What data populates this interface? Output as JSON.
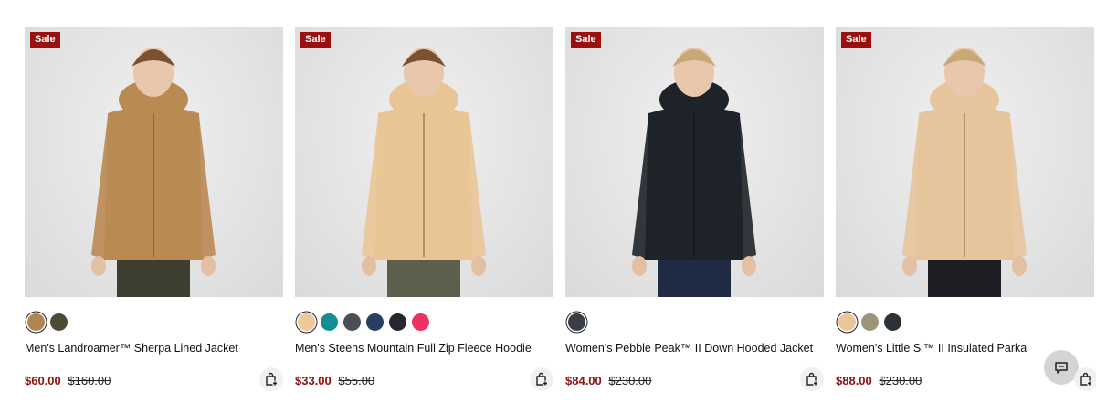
{
  "products": [
    {
      "badge": "Sale",
      "name": "Men's Landroamer™ Sherpa Lined Jacket",
      "sale_price": "$60.00",
      "original_price": "$160.00",
      "swatches": [
        "#b08554",
        "#4d4b36"
      ],
      "selected_swatch": 0,
      "jacket_color": "#b98a52",
      "pants_color": "#3d3d30"
    },
    {
      "badge": "Sale",
      "name": "Men's Steens Mountain Full Zip Fleece Hoodie",
      "sale_price": "$33.00",
      "original_price": "$55.00",
      "swatches": [
        "#edc89a",
        "#138f93",
        "#4b4f55",
        "#2a3e63",
        "#252830",
        "#ee3163"
      ],
      "selected_swatch": 0,
      "jacket_color": "#e9c595",
      "pants_color": "#5e5e4c"
    },
    {
      "badge": "Sale",
      "name": "Women's Pebble Peak™ II Down Hooded Jacket",
      "sale_price": "$84.00",
      "original_price": "$230.00",
      "swatches": [
        "#3a3f47"
      ],
      "selected_swatch": 0,
      "jacket_color": "#1e2329",
      "pants_color": "#1f2b45"
    },
    {
      "badge": "Sale",
      "name": "Women's Little Si™ II Insulated Parka",
      "sale_price": "$88.00",
      "original_price": "$230.00",
      "swatches": [
        "#ebc59a",
        "#9c957a",
        "#2c3138"
      ],
      "selected_swatch": 0,
      "jacket_color": "#e6c49c",
      "pants_color": "#1d1f24"
    }
  ],
  "colors": {
    "sale_badge": "#9b0f0f",
    "sale_price": "#8b1010"
  },
  "icons": {
    "cart": "add-to-bag-icon",
    "chat": "chat-icon"
  }
}
